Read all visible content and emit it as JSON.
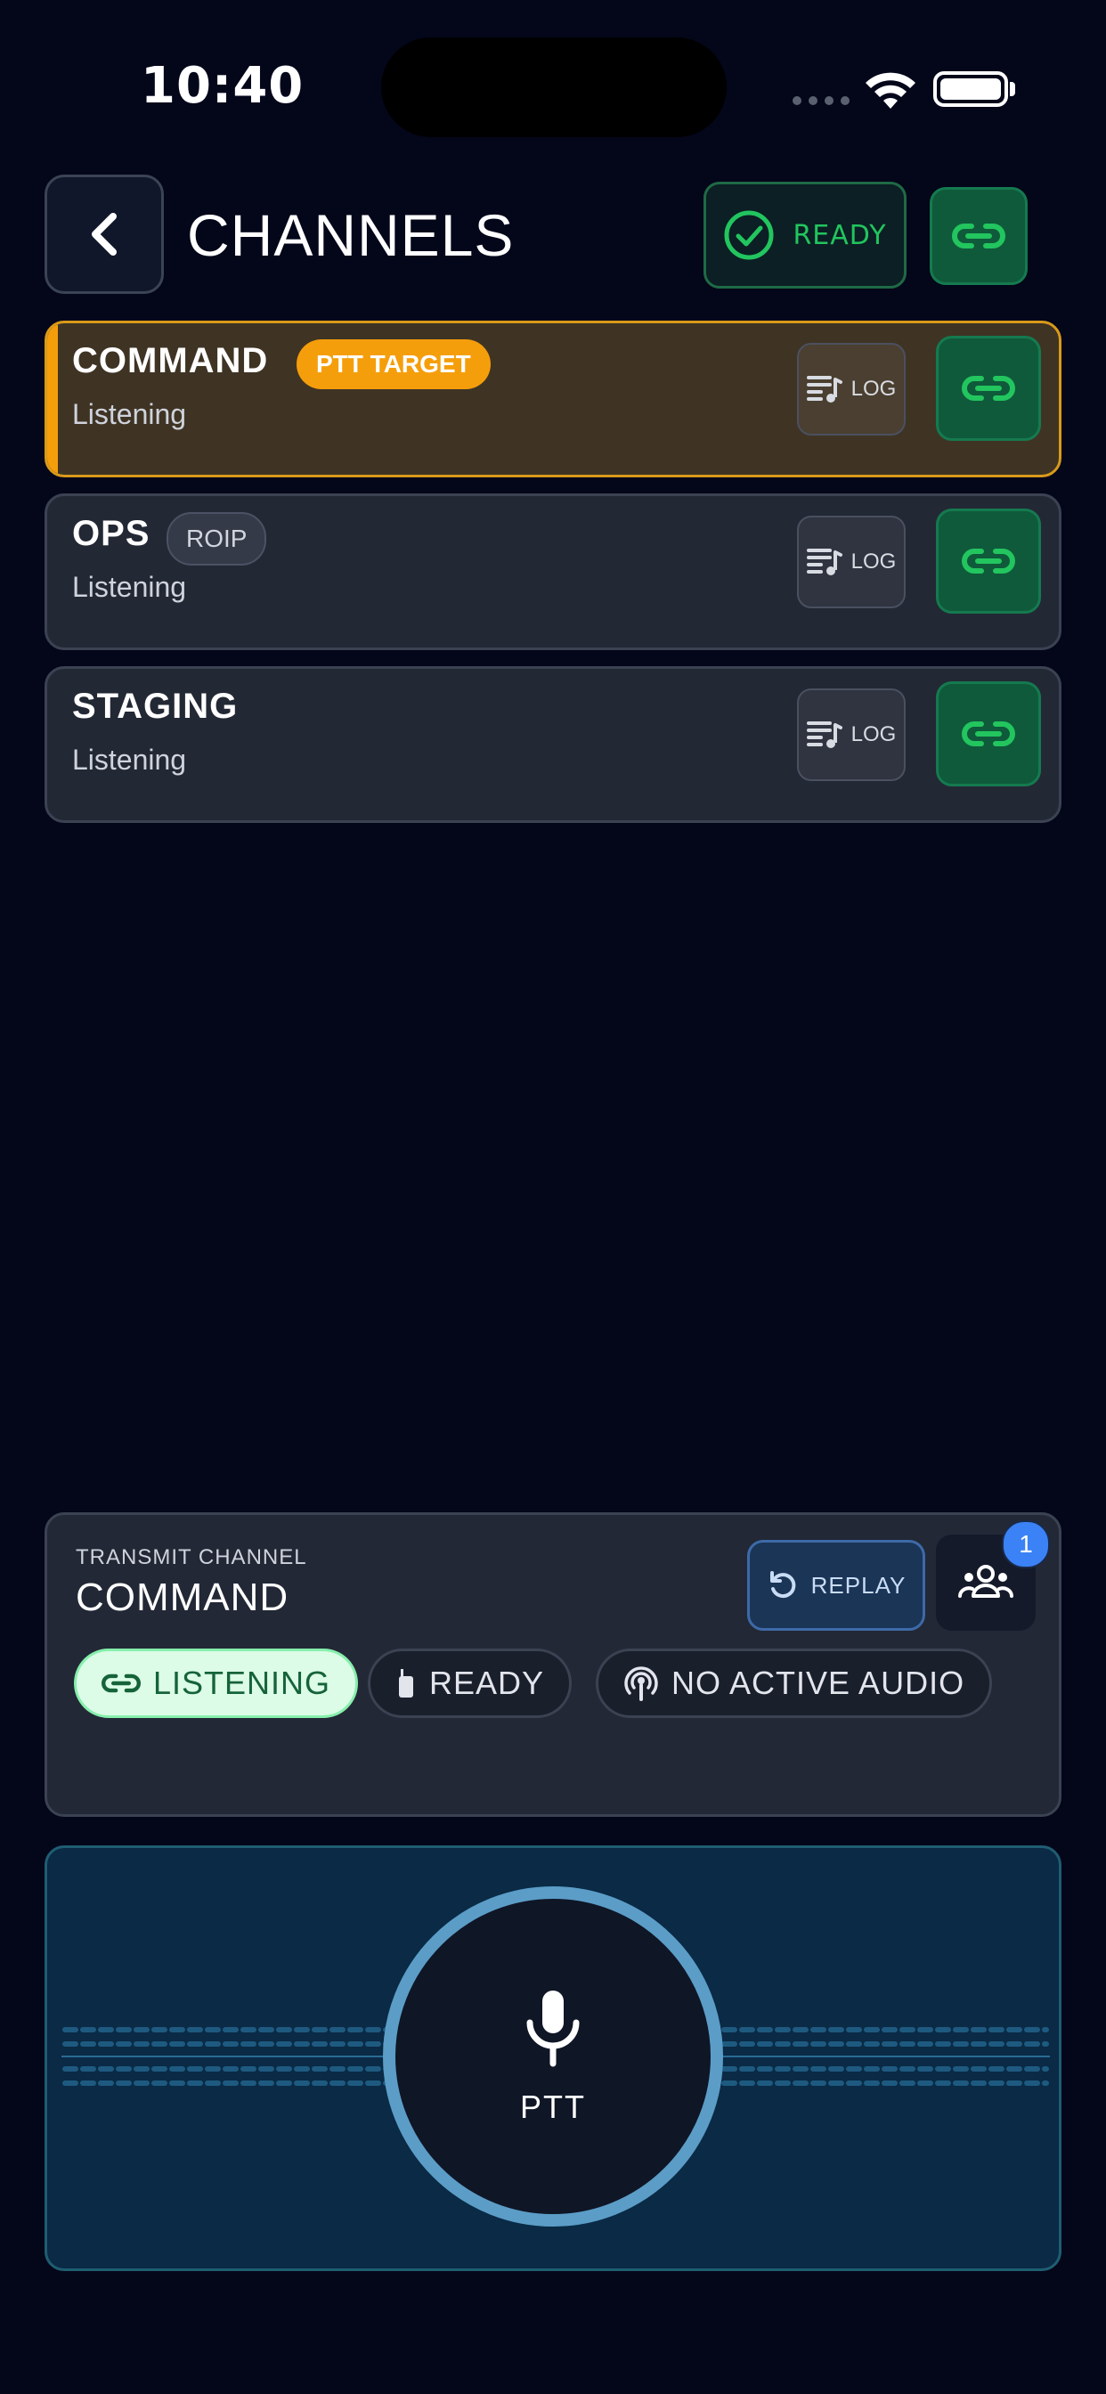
{
  "status_bar": {
    "time": "10:40"
  },
  "header": {
    "title": "CHANNELS",
    "ready_label": "READY"
  },
  "channels": [
    {
      "name": "COMMAND",
      "status": "Listening",
      "badge": "PTT TARGET",
      "log_label": "LOG"
    },
    {
      "name": "OPS",
      "status": "Listening",
      "badge": "ROIP",
      "log_label": "LOG"
    },
    {
      "name": "STAGING",
      "status": "Listening",
      "log_label": "LOG"
    }
  ],
  "transmit": {
    "label": "TRANSMIT CHANNEL",
    "channel": "COMMAND",
    "replay_label": "REPLAY",
    "users_count": "1",
    "chips": {
      "listening": "LISTENING",
      "ready": "READY",
      "audio": "NO ACTIVE AUDIO"
    }
  },
  "ptt": {
    "label": "PTT"
  },
  "colors": {
    "background": "#04061a",
    "accent_green": "#22c55e",
    "ptt_target": "#f59e0b",
    "replay_blue": "#3b82f6",
    "ptt_ring": "#5b9dc7"
  },
  "icons": [
    "back-chevron-icon",
    "check-circle-icon",
    "link-icon",
    "playlist-music-icon",
    "replay-icon",
    "users-icon",
    "handheld-radio-icon",
    "podcast-icon",
    "microphone-icon",
    "wifi-icon",
    "battery-icon"
  ]
}
